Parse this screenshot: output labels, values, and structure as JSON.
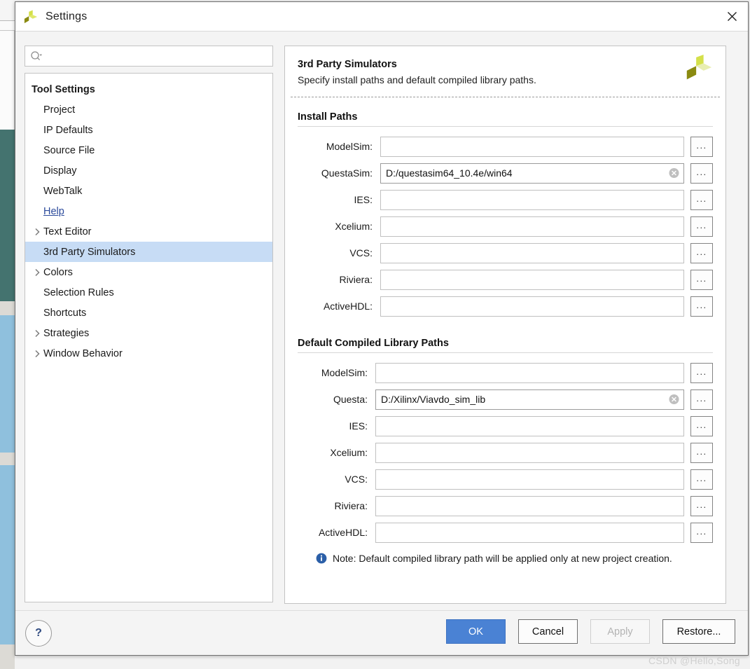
{
  "window": {
    "title": "Settings",
    "logo_icon": "vivado-logo-icon",
    "close_icon": "close-icon"
  },
  "search": {
    "value": "",
    "placeholder": "",
    "icon": "search-icon"
  },
  "sidebar": {
    "header": "Tool Settings",
    "items": [
      {
        "label": "Project",
        "expandable": false,
        "link": false,
        "selected": false
      },
      {
        "label": "IP Defaults",
        "expandable": false,
        "link": false,
        "selected": false
      },
      {
        "label": "Source File",
        "expandable": false,
        "link": false,
        "selected": false
      },
      {
        "label": "Display",
        "expandable": false,
        "link": false,
        "selected": false
      },
      {
        "label": "WebTalk",
        "expandable": false,
        "link": false,
        "selected": false
      },
      {
        "label": "Help",
        "expandable": false,
        "link": true,
        "selected": false
      },
      {
        "label": "Text Editor",
        "expandable": true,
        "link": false,
        "selected": false
      },
      {
        "label": "3rd Party Simulators",
        "expandable": false,
        "link": false,
        "selected": true
      },
      {
        "label": "Colors",
        "expandable": true,
        "link": false,
        "selected": false
      },
      {
        "label": "Selection Rules",
        "expandable": false,
        "link": false,
        "selected": false
      },
      {
        "label": "Shortcuts",
        "expandable": false,
        "link": false,
        "selected": false
      },
      {
        "label": "Strategies",
        "expandable": true,
        "link": false,
        "selected": false
      },
      {
        "label": "Window Behavior",
        "expandable": true,
        "link": false,
        "selected": false
      }
    ]
  },
  "page": {
    "title": "3rd Party Simulators",
    "subtitle": "Specify install paths and default compiled library paths.",
    "logo_icon": "vivado-logo-icon"
  },
  "install_paths": {
    "title": "Install Paths",
    "browse_label": "...",
    "rows": [
      {
        "label": "ModelSim:",
        "value": "",
        "has_clear": false
      },
      {
        "label": "QuestaSim:",
        "value": "D:/questasim64_10.4e/win64",
        "has_clear": true
      },
      {
        "label": "IES:",
        "value": "",
        "has_clear": false
      },
      {
        "label": "Xcelium:",
        "value": "",
        "has_clear": false
      },
      {
        "label": "VCS:",
        "value": "",
        "has_clear": false
      },
      {
        "label": "Riviera:",
        "value": "",
        "has_clear": false
      },
      {
        "label": "ActiveHDL:",
        "value": "",
        "has_clear": false
      }
    ]
  },
  "compiled_library_paths": {
    "title": "Default Compiled Library Paths",
    "browse_label": "...",
    "rows": [
      {
        "label": "ModelSim:",
        "value": "",
        "has_clear": false
      },
      {
        "label": "Questa:",
        "value": "D:/Xilinx/Viavdo_sim_lib",
        "has_clear": true
      },
      {
        "label": "IES:",
        "value": "",
        "has_clear": false
      },
      {
        "label": "Xcelium:",
        "value": "",
        "has_clear": false
      },
      {
        "label": "VCS:",
        "value": "",
        "has_clear": false
      },
      {
        "label": "Riviera:",
        "value": "",
        "has_clear": false
      },
      {
        "label": "ActiveHDL:",
        "value": "",
        "has_clear": false
      }
    ],
    "note": "Note: Default compiled library path will be applied only at new project creation.",
    "note_icon": "info-icon"
  },
  "footer": {
    "help_label": "?",
    "buttons": [
      {
        "label": "OK",
        "style": "primary",
        "disabled": false
      },
      {
        "label": "Cancel",
        "style": "normal",
        "disabled": false
      },
      {
        "label": "Apply",
        "style": "normal",
        "disabled": true
      },
      {
        "label": "Restore...",
        "style": "normal",
        "disabled": false
      }
    ]
  },
  "watermark": "CSDN @Hello,Song",
  "colors": {
    "accent_blue": "#4a82d4",
    "selection_blue": "#c7dcf5",
    "link_blue": "#2b4a9b",
    "logo_bright": "#d4e04a",
    "logo_dark": "#8a8a10",
    "logo_pale": "#e8eeb0",
    "info_blue": "#2b5fa8",
    "bg_teal": "#44736f",
    "bg_lightblue": "#8fc0dd"
  }
}
